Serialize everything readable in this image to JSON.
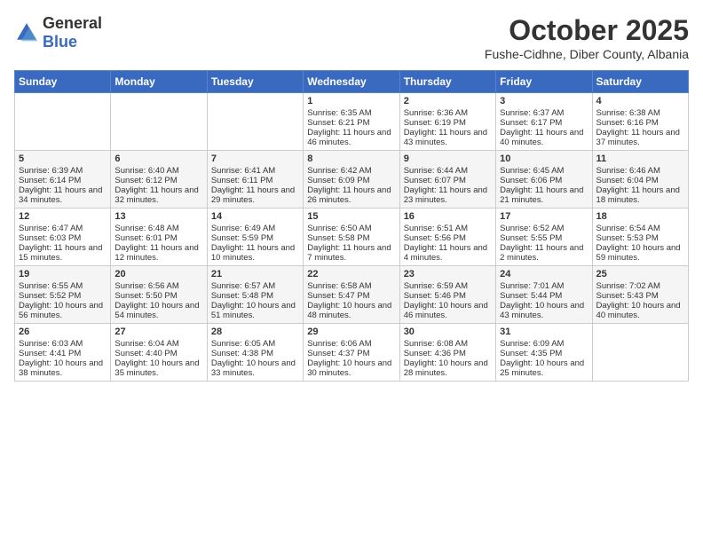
{
  "header": {
    "logo": {
      "general": "General",
      "blue": "Blue"
    },
    "title": "October 2025",
    "location": "Fushe-Cidhne, Diber County, Albania"
  },
  "days_of_week": [
    "Sunday",
    "Monday",
    "Tuesday",
    "Wednesday",
    "Thursday",
    "Friday",
    "Saturday"
  ],
  "weeks": [
    {
      "bg": "white",
      "days": [
        {
          "num": "",
          "sunrise": "",
          "sunset": "",
          "daylight": ""
        },
        {
          "num": "",
          "sunrise": "",
          "sunset": "",
          "daylight": ""
        },
        {
          "num": "",
          "sunrise": "",
          "sunset": "",
          "daylight": ""
        },
        {
          "num": "1",
          "sunrise": "Sunrise: 6:35 AM",
          "sunset": "Sunset: 6:21 PM",
          "daylight": "Daylight: 11 hours and 46 minutes."
        },
        {
          "num": "2",
          "sunrise": "Sunrise: 6:36 AM",
          "sunset": "Sunset: 6:19 PM",
          "daylight": "Daylight: 11 hours and 43 minutes."
        },
        {
          "num": "3",
          "sunrise": "Sunrise: 6:37 AM",
          "sunset": "Sunset: 6:17 PM",
          "daylight": "Daylight: 11 hours and 40 minutes."
        },
        {
          "num": "4",
          "sunrise": "Sunrise: 6:38 AM",
          "sunset": "Sunset: 6:16 PM",
          "daylight": "Daylight: 11 hours and 37 minutes."
        }
      ]
    },
    {
      "bg": "light",
      "days": [
        {
          "num": "5",
          "sunrise": "Sunrise: 6:39 AM",
          "sunset": "Sunset: 6:14 PM",
          "daylight": "Daylight: 11 hours and 34 minutes."
        },
        {
          "num": "6",
          "sunrise": "Sunrise: 6:40 AM",
          "sunset": "Sunset: 6:12 PM",
          "daylight": "Daylight: 11 hours and 32 minutes."
        },
        {
          "num": "7",
          "sunrise": "Sunrise: 6:41 AM",
          "sunset": "Sunset: 6:11 PM",
          "daylight": "Daylight: 11 hours and 29 minutes."
        },
        {
          "num": "8",
          "sunrise": "Sunrise: 6:42 AM",
          "sunset": "Sunset: 6:09 PM",
          "daylight": "Daylight: 11 hours and 26 minutes."
        },
        {
          "num": "9",
          "sunrise": "Sunrise: 6:44 AM",
          "sunset": "Sunset: 6:07 PM",
          "daylight": "Daylight: 11 hours and 23 minutes."
        },
        {
          "num": "10",
          "sunrise": "Sunrise: 6:45 AM",
          "sunset": "Sunset: 6:06 PM",
          "daylight": "Daylight: 11 hours and 21 minutes."
        },
        {
          "num": "11",
          "sunrise": "Sunrise: 6:46 AM",
          "sunset": "Sunset: 6:04 PM",
          "daylight": "Daylight: 11 hours and 18 minutes."
        }
      ]
    },
    {
      "bg": "white",
      "days": [
        {
          "num": "12",
          "sunrise": "Sunrise: 6:47 AM",
          "sunset": "Sunset: 6:03 PM",
          "daylight": "Daylight: 11 hours and 15 minutes."
        },
        {
          "num": "13",
          "sunrise": "Sunrise: 6:48 AM",
          "sunset": "Sunset: 6:01 PM",
          "daylight": "Daylight: 11 hours and 12 minutes."
        },
        {
          "num": "14",
          "sunrise": "Sunrise: 6:49 AM",
          "sunset": "Sunset: 5:59 PM",
          "daylight": "Daylight: 11 hours and 10 minutes."
        },
        {
          "num": "15",
          "sunrise": "Sunrise: 6:50 AM",
          "sunset": "Sunset: 5:58 PM",
          "daylight": "Daylight: 11 hours and 7 minutes."
        },
        {
          "num": "16",
          "sunrise": "Sunrise: 6:51 AM",
          "sunset": "Sunset: 5:56 PM",
          "daylight": "Daylight: 11 hours and 4 minutes."
        },
        {
          "num": "17",
          "sunrise": "Sunrise: 6:52 AM",
          "sunset": "Sunset: 5:55 PM",
          "daylight": "Daylight: 11 hours and 2 minutes."
        },
        {
          "num": "18",
          "sunrise": "Sunrise: 6:54 AM",
          "sunset": "Sunset: 5:53 PM",
          "daylight": "Daylight: 10 hours and 59 minutes."
        }
      ]
    },
    {
      "bg": "light",
      "days": [
        {
          "num": "19",
          "sunrise": "Sunrise: 6:55 AM",
          "sunset": "Sunset: 5:52 PM",
          "daylight": "Daylight: 10 hours and 56 minutes."
        },
        {
          "num": "20",
          "sunrise": "Sunrise: 6:56 AM",
          "sunset": "Sunset: 5:50 PM",
          "daylight": "Daylight: 10 hours and 54 minutes."
        },
        {
          "num": "21",
          "sunrise": "Sunrise: 6:57 AM",
          "sunset": "Sunset: 5:48 PM",
          "daylight": "Daylight: 10 hours and 51 minutes."
        },
        {
          "num": "22",
          "sunrise": "Sunrise: 6:58 AM",
          "sunset": "Sunset: 5:47 PM",
          "daylight": "Daylight: 10 hours and 48 minutes."
        },
        {
          "num": "23",
          "sunrise": "Sunrise: 6:59 AM",
          "sunset": "Sunset: 5:46 PM",
          "daylight": "Daylight: 10 hours and 46 minutes."
        },
        {
          "num": "24",
          "sunrise": "Sunrise: 7:01 AM",
          "sunset": "Sunset: 5:44 PM",
          "daylight": "Daylight: 10 hours and 43 minutes."
        },
        {
          "num": "25",
          "sunrise": "Sunrise: 7:02 AM",
          "sunset": "Sunset: 5:43 PM",
          "daylight": "Daylight: 10 hours and 40 minutes."
        }
      ]
    },
    {
      "bg": "white",
      "days": [
        {
          "num": "26",
          "sunrise": "Sunrise: 6:03 AM",
          "sunset": "Sunset: 4:41 PM",
          "daylight": "Daylight: 10 hours and 38 minutes."
        },
        {
          "num": "27",
          "sunrise": "Sunrise: 6:04 AM",
          "sunset": "Sunset: 4:40 PM",
          "daylight": "Daylight: 10 hours and 35 minutes."
        },
        {
          "num": "28",
          "sunrise": "Sunrise: 6:05 AM",
          "sunset": "Sunset: 4:38 PM",
          "daylight": "Daylight: 10 hours and 33 minutes."
        },
        {
          "num": "29",
          "sunrise": "Sunrise: 6:06 AM",
          "sunset": "Sunset: 4:37 PM",
          "daylight": "Daylight: 10 hours and 30 minutes."
        },
        {
          "num": "30",
          "sunrise": "Sunrise: 6:08 AM",
          "sunset": "Sunset: 4:36 PM",
          "daylight": "Daylight: 10 hours and 28 minutes."
        },
        {
          "num": "31",
          "sunrise": "Sunrise: 6:09 AM",
          "sunset": "Sunset: 4:35 PM",
          "daylight": "Daylight: 10 hours and 25 minutes."
        },
        {
          "num": "",
          "sunrise": "",
          "sunset": "",
          "daylight": ""
        }
      ]
    }
  ]
}
